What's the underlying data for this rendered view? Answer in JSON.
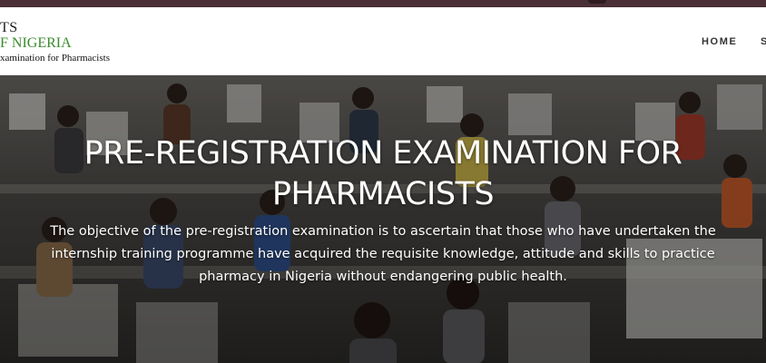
{
  "logo": {
    "line1": "TS",
    "line2": "F NIGERIA",
    "line3": "xamination for Pharmacists"
  },
  "nav": {
    "items": [
      "HOME",
      "S"
    ]
  },
  "hero": {
    "title": "PRE-REGISTRATION EXAMINATION FOR PHARMACISTS",
    "description": "The objective of the pre-registration examination is to ascertain that those who have undertaken the internship training programme have acquired the requisite knowledge, attitude and skills to practice pharmacy in Nigeria without endangering public health."
  },
  "colors": {
    "topbar": "#4a2f37",
    "logo_accent": "#3a8a2e",
    "nav_text": "#333333",
    "hero_text": "#ffffff"
  }
}
